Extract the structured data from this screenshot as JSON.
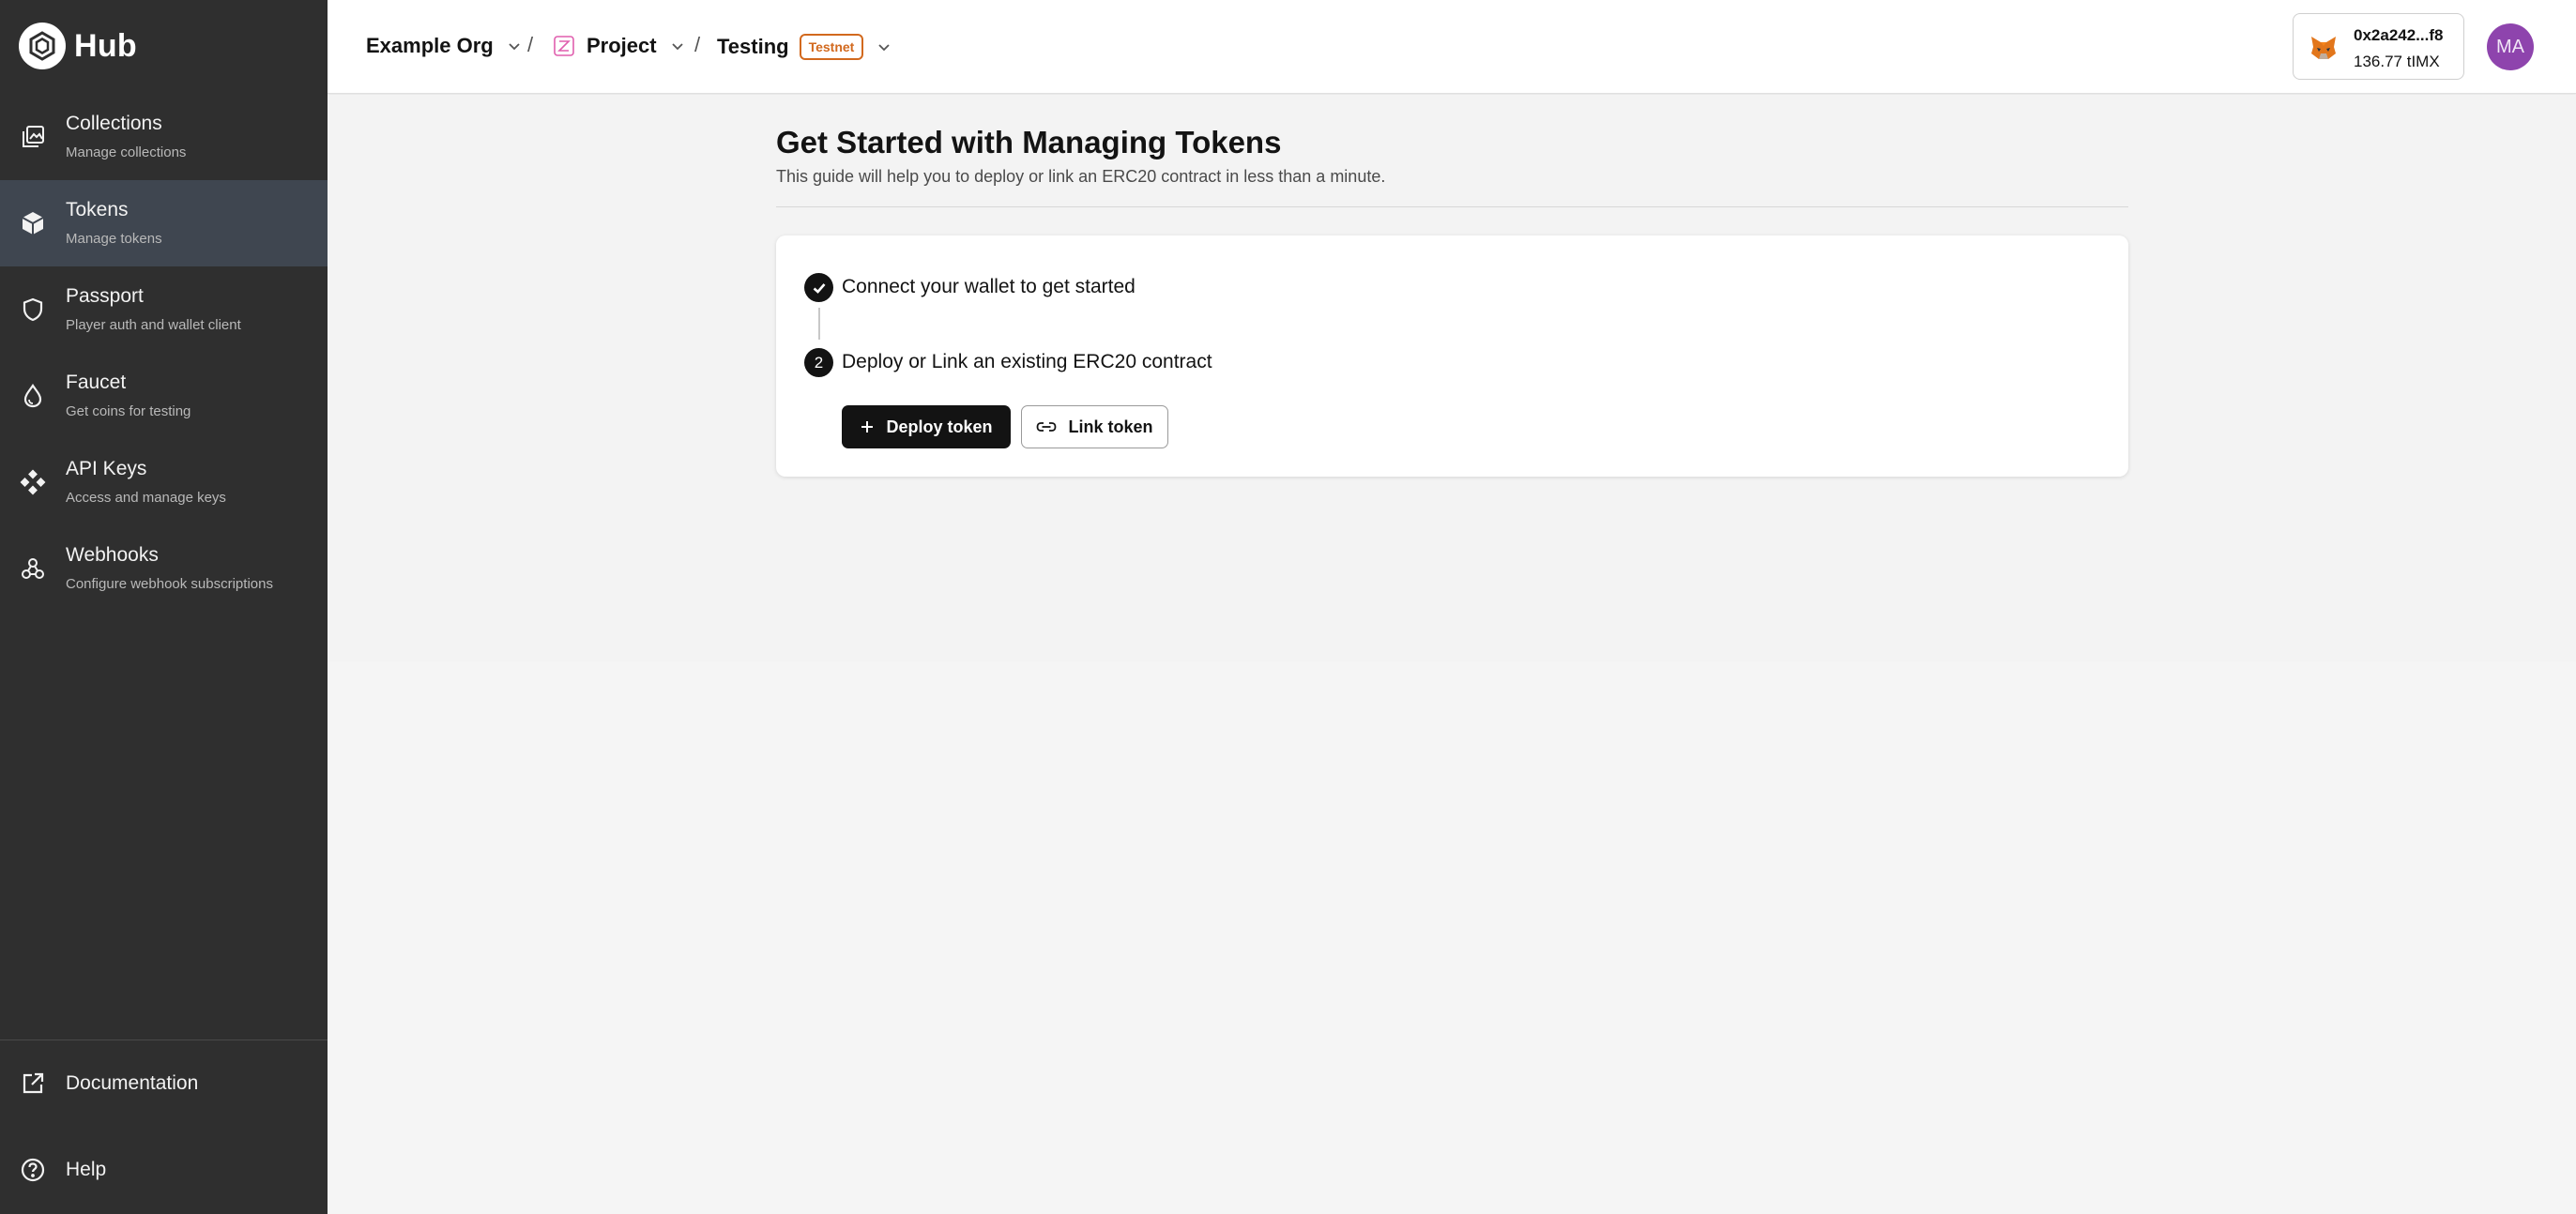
{
  "app": {
    "name": "Hub",
    "colors": {
      "sidebar": "#2f2f2f",
      "sidebar_active": "#3f4650",
      "badge": "#d2691e",
      "avatar": "#8e44ad",
      "primary": "#131313"
    }
  },
  "sidebar": {
    "items": [
      {
        "title": "Collections",
        "subtitle": "Manage collections",
        "icon": "collections-icon",
        "active": false
      },
      {
        "title": "Tokens",
        "subtitle": "Manage tokens",
        "icon": "cube-icon",
        "active": true
      },
      {
        "title": "Passport",
        "subtitle": "Player auth and wallet client",
        "icon": "shield-icon",
        "active": false
      },
      {
        "title": "Faucet",
        "subtitle": "Get coins for testing",
        "icon": "droplet-icon",
        "active": false
      },
      {
        "title": "API Keys",
        "subtitle": "Access and manage keys",
        "icon": "diamond-nodes-icon",
        "active": false
      },
      {
        "title": "Webhooks",
        "subtitle": "Configure webhook subscriptions",
        "icon": "webhook-icon",
        "active": false
      }
    ],
    "bottom": [
      {
        "title": "Documentation",
        "icon": "external-link-icon"
      },
      {
        "title": "Help",
        "icon": "help-circle-icon"
      }
    ]
  },
  "header": {
    "org": "Example Org",
    "separator": "/",
    "project": "Project",
    "environment": "Testing",
    "environment_badge": "Testnet",
    "wallet": {
      "address": "0x2a242...f8",
      "balance": "136.77 tIMX"
    },
    "avatar_initials": "MA"
  },
  "main": {
    "title": "Get Started with Managing Tokens",
    "subtitle": "This guide will help you to deploy or link an ERC20 contract in less than a minute.",
    "steps": [
      {
        "number": "1",
        "label": "Connect your wallet to get started",
        "completed": true
      },
      {
        "number": "2",
        "label": "Deploy or Link an existing ERC20 contract",
        "completed": false
      }
    ],
    "actions": {
      "deploy_label": "Deploy token",
      "link_label": "Link token"
    }
  }
}
